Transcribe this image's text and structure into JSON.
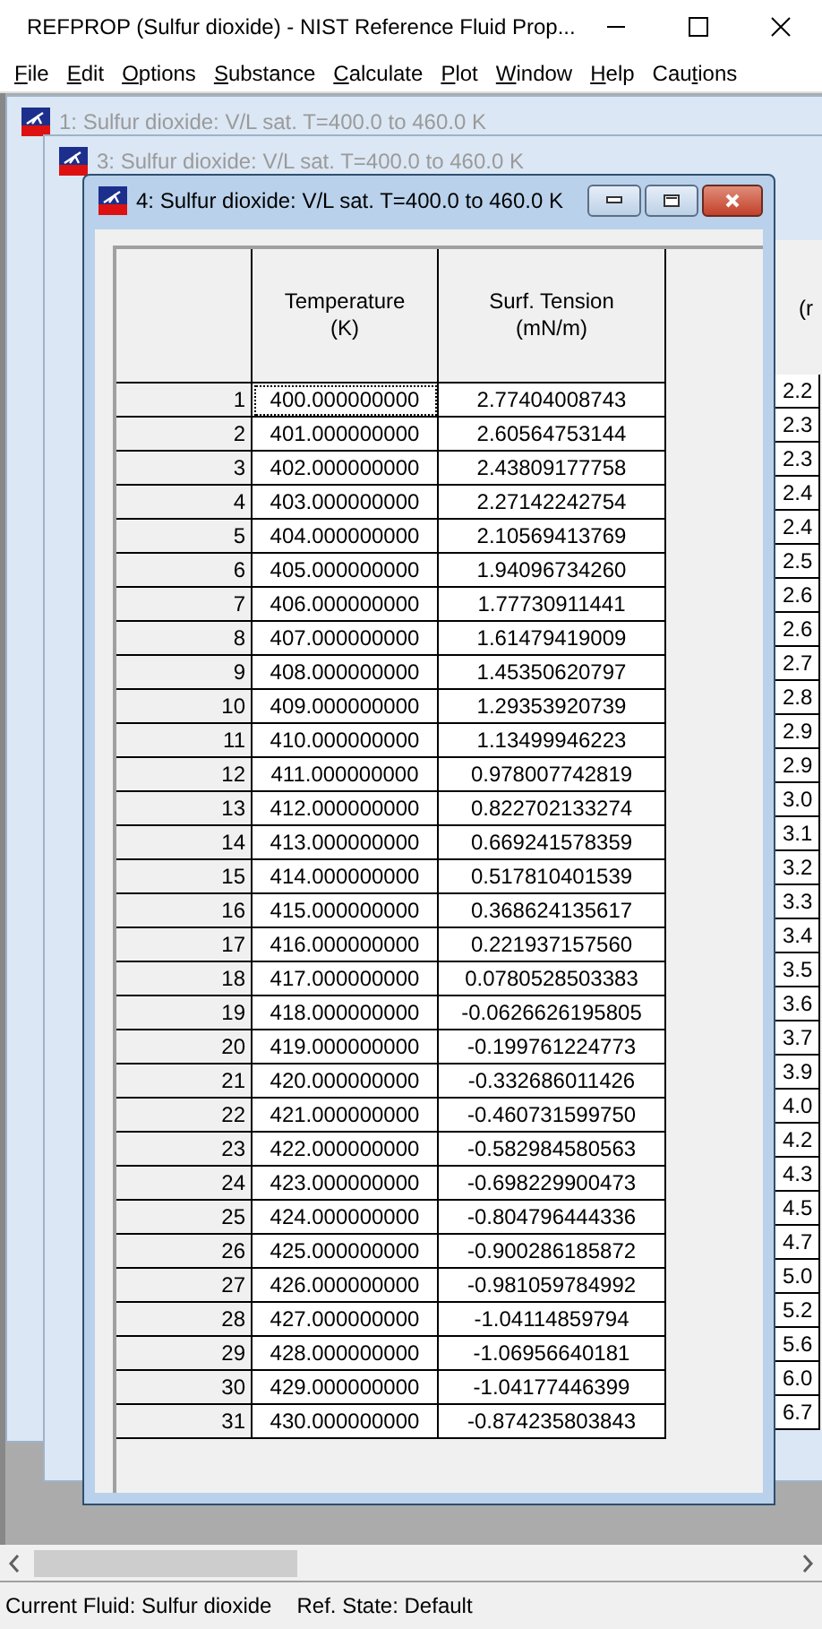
{
  "window": {
    "title": "REFPROP (Sulfur dioxide) - NIST Reference Fluid Prop..."
  },
  "menu": [
    {
      "label": "File"
    },
    {
      "label": "Edit"
    },
    {
      "label": "Options"
    },
    {
      "label": "Substance"
    },
    {
      "label": "Calculate"
    },
    {
      "label": "Plot"
    },
    {
      "label": "Window"
    },
    {
      "label": "Help"
    },
    {
      "label": "Cautions"
    }
  ],
  "back_windows": [
    {
      "title": "1: Sulfur dioxide: V/L sat. T=400.0 to 460.0 K"
    },
    {
      "title": "3: Sulfur dioxide: V/L sat. T=400.0 to 460.0 K",
      "column_header": "(r",
      "column_values": [
        "2.2",
        "2.3",
        "2.3",
        "2.4",
        "2.4",
        "2.5",
        "2.6",
        "2.6",
        "2.7",
        "2.8",
        "2.9",
        "2.9",
        "3.0",
        "3.1",
        "3.2",
        "3.3",
        "3.4",
        "3.5",
        "3.6",
        "3.7",
        "3.9",
        "4.0",
        "4.2",
        "4.3",
        "4.5",
        "4.7",
        "5.0",
        "5.2",
        "5.6",
        "6.0",
        "6.7"
      ]
    }
  ],
  "table_window": {
    "title": "4: Sulfur dioxide: V/L sat. T=400.0 to 460.0 K",
    "columns": [
      {},
      {
        "name": "Temperature",
        "unit": "(K)"
      },
      {
        "name": "Surf. Tension",
        "unit": "(mN/m)"
      }
    ],
    "rows": [
      [
        "1",
        "400.000000000",
        "2.77404008743",
        true
      ],
      [
        "2",
        "401.000000000",
        "2.60564753144",
        false
      ],
      [
        "3",
        "402.000000000",
        "2.43809177758",
        false
      ],
      [
        "4",
        "403.000000000",
        "2.27142242754",
        false
      ],
      [
        "5",
        "404.000000000",
        "2.10569413769",
        false
      ],
      [
        "6",
        "405.000000000",
        "1.94096734260",
        false
      ],
      [
        "7",
        "406.000000000",
        "1.77730911441",
        false
      ],
      [
        "8",
        "407.000000000",
        "1.61479419009",
        false
      ],
      [
        "9",
        "408.000000000",
        "1.45350620797",
        false
      ],
      [
        "10",
        "409.000000000",
        "1.29353920739",
        false
      ],
      [
        "11",
        "410.000000000",
        "1.13499946223",
        false
      ],
      [
        "12",
        "411.000000000",
        "0.978007742819",
        false
      ],
      [
        "13",
        "412.000000000",
        "0.822702133274",
        false
      ],
      [
        "14",
        "413.000000000",
        "0.669241578359",
        false
      ],
      [
        "15",
        "414.000000000",
        "0.517810401539",
        false
      ],
      [
        "16",
        "415.000000000",
        "0.368624135617",
        false
      ],
      [
        "17",
        "416.000000000",
        "0.221937157560",
        false
      ],
      [
        "18",
        "417.000000000",
        "0.0780528503383",
        false
      ],
      [
        "19",
        "418.000000000",
        "-0.0626626195805",
        false
      ],
      [
        "20",
        "419.000000000",
        "-0.199761224773",
        false
      ],
      [
        "21",
        "420.000000000",
        "-0.332686011426",
        false
      ],
      [
        "22",
        "421.000000000",
        "-0.460731599750",
        false
      ],
      [
        "23",
        "422.000000000",
        "-0.582984580563",
        false
      ],
      [
        "24",
        "423.000000000",
        "-0.698229900473",
        false
      ],
      [
        "25",
        "424.000000000",
        "-0.804796444336",
        false
      ],
      [
        "26",
        "425.000000000",
        "-0.900286185872",
        false
      ],
      [
        "27",
        "426.000000000",
        "-0.981059784992",
        false
      ],
      [
        "28",
        "427.000000000",
        "-1.04114859794",
        false
      ],
      [
        "29",
        "428.000000000",
        "-1.06956640181",
        false
      ],
      [
        "30",
        "429.000000000",
        "-1.04177446399",
        false
      ],
      [
        "31",
        "430.000000000",
        "-0.874235803843",
        false
      ]
    ]
  },
  "status_bar": {
    "fluid": "Current Fluid: Sulfur dioxide",
    "ref_state": "Ref. State: Default"
  }
}
